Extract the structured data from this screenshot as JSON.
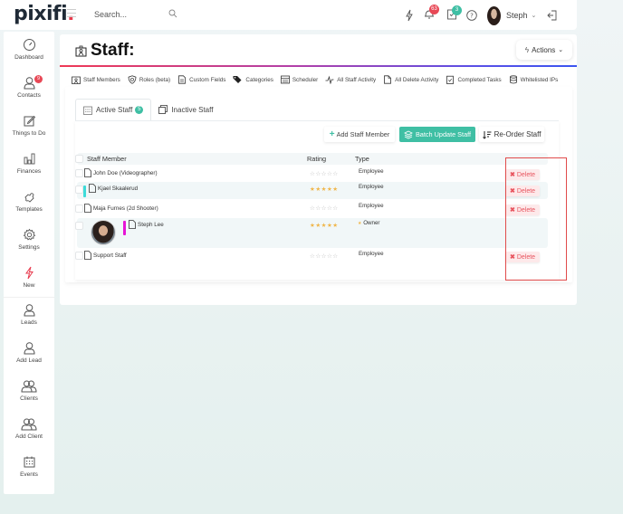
{
  "topbar": {
    "logo": "pixifi",
    "logo_dot": ".",
    "search_placeholder": "Search...",
    "notifications_count": "63",
    "tasks_count": "3",
    "user_name": "Steph",
    "colors": {
      "notification_badge": "#e84856",
      "tasks_badge": "#3fbfa4"
    }
  },
  "sidebar": {
    "items": [
      {
        "label": "Dashboard",
        "icon": "dashboard-gauge-icon"
      },
      {
        "label": "Contacts",
        "icon": "contact-person-icon",
        "badge": "9"
      },
      {
        "label": "Things to Do",
        "icon": "edit-square-icon"
      },
      {
        "label": "Finances",
        "icon": "bar-chart-icon"
      },
      {
        "label": "Templates",
        "icon": "puzzle-icon"
      },
      {
        "label": "Settings",
        "icon": "gear-icon"
      },
      {
        "label": "New",
        "icon": "lightning-icon"
      },
      {
        "label": "Leads",
        "icon": "person-icon"
      },
      {
        "label": "Add Lead",
        "icon": "person-icon"
      },
      {
        "label": "Clients",
        "icon": "people-icon"
      },
      {
        "label": "Add Client",
        "icon": "people-icon"
      },
      {
        "label": "Events",
        "icon": "calendar-icon"
      }
    ]
  },
  "page": {
    "title": "Staff:",
    "actions_label": "Actions",
    "subnav": [
      {
        "label": "Staff Members",
        "icon": "staff-badge-icon"
      },
      {
        "label": "Roles (beta)",
        "icon": "shield-icon"
      },
      {
        "label": "Custom Fields",
        "icon": "document-icon"
      },
      {
        "label": "Categories",
        "icon": "tags-icon"
      },
      {
        "label": "Scheduler",
        "icon": "calendar-grid-icon"
      },
      {
        "label": "All Staff Activity",
        "icon": "activity-pulse-icon"
      },
      {
        "label": "All Delete Activity",
        "icon": "file-icon"
      },
      {
        "label": "Completed Tasks",
        "icon": "clipboard-check-icon"
      },
      {
        "label": "Whitelisted IPs",
        "icon": "database-icon"
      }
    ],
    "tabs": [
      {
        "label": "Active Staff",
        "badge": "5",
        "active": true
      },
      {
        "label": "Inactive Staff",
        "active": false
      }
    ],
    "buttons": {
      "add": "Add Staff Member",
      "batch": "Batch Update Staff",
      "reorder": "Re-Order Staff"
    },
    "table": {
      "columns": [
        "Staff Member",
        "Rating",
        "Type"
      ],
      "rows": [
        {
          "name": "John Doe (Videographer)",
          "rating": 0,
          "type": "Employee",
          "delete": "Delete"
        },
        {
          "name": "Kjael Skaalerud",
          "rating": 5,
          "type": "Employee",
          "delete": "Delete",
          "color": "#3ddbd9"
        },
        {
          "name": "Maja Furnes (2d Shooter)",
          "rating": 0,
          "type": "Employee",
          "delete": "Delete"
        },
        {
          "name": "Steph Lee",
          "rating": 5,
          "type": "Owner",
          "color": "#e615d6"
        },
        {
          "name": "Support Staff",
          "rating": 0,
          "type": "Employee",
          "delete": "Delete"
        }
      ],
      "stars_gray": "☆☆☆☆☆",
      "stars_gold": "★★★★★",
      "owner_star": "★"
    }
  }
}
